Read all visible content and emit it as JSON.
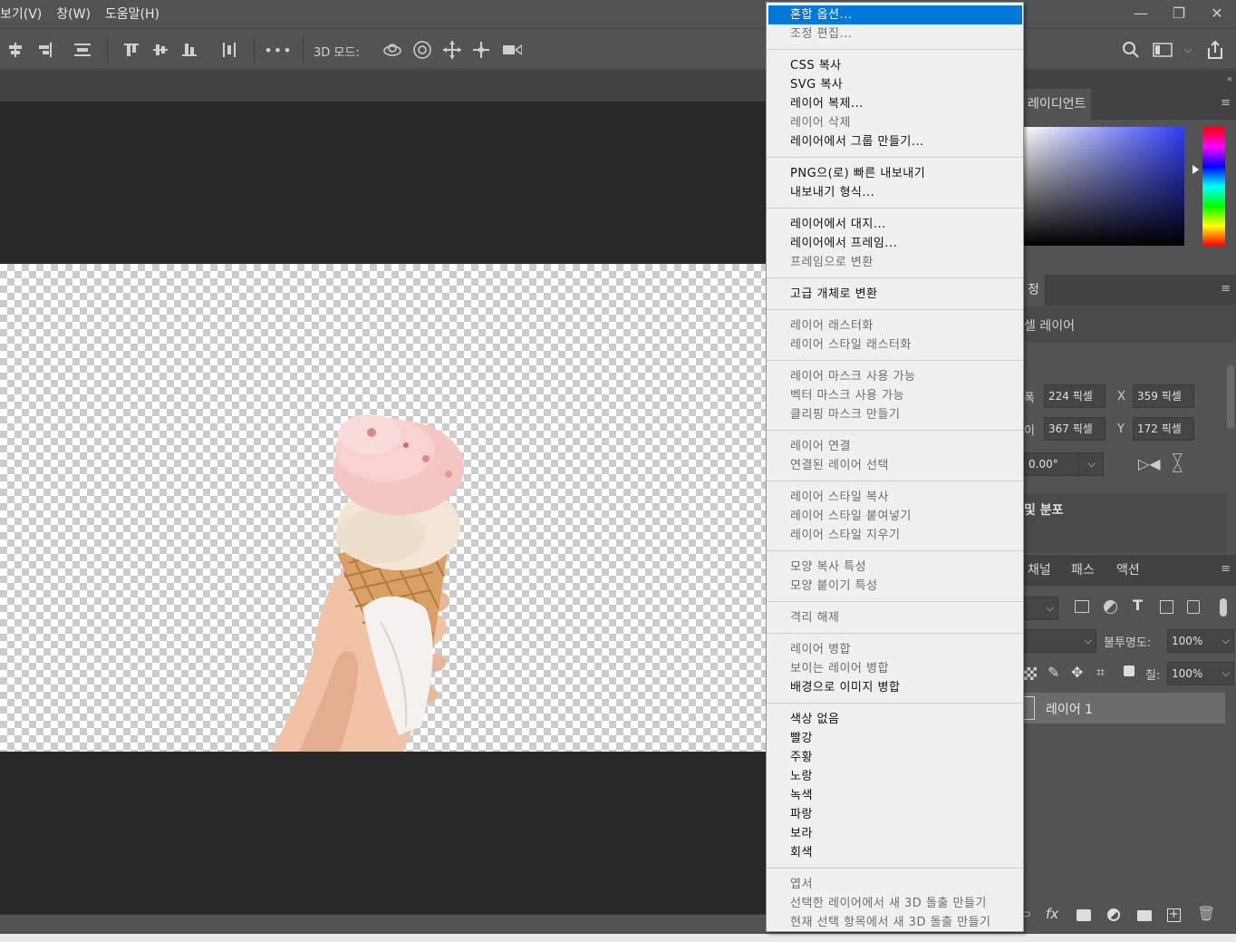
{
  "menubar": {
    "items": [
      "보기(V)",
      "창(W)",
      "도움말(H)"
    ]
  },
  "window_controls": {
    "minimize": "—",
    "restore": "❐",
    "close": "✕"
  },
  "toolbar": {
    "mode_label": "3D 모드:"
  },
  "context_menu": {
    "groups": [
      [
        {
          "label": "혼합 옵션...",
          "state": "selected"
        },
        {
          "label": "조정 편집...",
          "state": "disabled"
        }
      ],
      [
        {
          "label": "CSS 복사",
          "state": "enabled"
        },
        {
          "label": "SVG 복사",
          "state": "enabled"
        },
        {
          "label": "레이어 복제...",
          "state": "enabled"
        },
        {
          "label": "레이어 삭제",
          "state": "disabled"
        },
        {
          "label": "레이어에서 그룹 만들기...",
          "state": "enabled"
        }
      ],
      [
        {
          "label": "PNG으(로) 빠른 내보내기",
          "state": "enabled"
        },
        {
          "label": "내보내기 형식...",
          "state": "enabled"
        }
      ],
      [
        {
          "label": "레이어에서 대지...",
          "state": "enabled"
        },
        {
          "label": "레이어에서 프레임...",
          "state": "enabled"
        },
        {
          "label": "프레임으로 변환",
          "state": "disabled"
        }
      ],
      [
        {
          "label": "고급 개체로 변환",
          "state": "enabled"
        }
      ],
      [
        {
          "label": "레이어 래스터화",
          "state": "disabled"
        },
        {
          "label": "레이어 스타일 래스터화",
          "state": "disabled"
        }
      ],
      [
        {
          "label": "레이어 마스크 사용 가능",
          "state": "disabled"
        },
        {
          "label": "벡터 마스크 사용 가능",
          "state": "disabled"
        },
        {
          "label": "클리핑 마스크 만들기",
          "state": "disabled"
        }
      ],
      [
        {
          "label": "레이어 연결",
          "state": "disabled"
        },
        {
          "label": "연결된 레이어 선택",
          "state": "disabled"
        }
      ],
      [
        {
          "label": "레이어 스타일 복사",
          "state": "disabled"
        },
        {
          "label": "레이어 스타일 붙여넣기",
          "state": "disabled"
        },
        {
          "label": "레이어 스타일 지우기",
          "state": "disabled"
        }
      ],
      [
        {
          "label": "모양 복사 특성",
          "state": "disabled"
        },
        {
          "label": "모양 붙이기 특성",
          "state": "disabled"
        }
      ],
      [
        {
          "label": "격리 해제",
          "state": "disabled"
        }
      ],
      [
        {
          "label": "레이어 병합",
          "state": "disabled"
        },
        {
          "label": "보이는 레이어 병합",
          "state": "disabled"
        },
        {
          "label": "배경으로 이미지 병합",
          "state": "enabled"
        }
      ],
      [
        {
          "label": "색상 없음",
          "state": "enabled"
        },
        {
          "label": "빨강",
          "state": "enabled"
        },
        {
          "label": "주황",
          "state": "enabled"
        },
        {
          "label": "노랑",
          "state": "enabled"
        },
        {
          "label": "녹색",
          "state": "enabled"
        },
        {
          "label": "파랑",
          "state": "enabled"
        },
        {
          "label": "보라",
          "state": "enabled"
        },
        {
          "label": "회색",
          "state": "enabled"
        }
      ],
      [
        {
          "label": "엽서",
          "state": "disabled"
        },
        {
          "label": "선택한 레이어에서 새 3D 돌출 만들기",
          "state": "disabled"
        },
        {
          "label": "현재 선택 항목에서 새 3D 돌출 만들기",
          "state": "disabled"
        }
      ]
    ]
  },
  "gradient_panel": {
    "tab_label": "레이디언트"
  },
  "properties_panel": {
    "tab_label": "정",
    "layer_type": "셀 레이어",
    "w_label": "폭",
    "w_value": "224 픽셀",
    "h_label": "이",
    "h_value": "367 픽셀",
    "x_label": "X",
    "x_value": "359 픽셀",
    "y_label": "Y",
    "y_value": "172 픽셀",
    "angle_value": "0.00°",
    "distribute_label": "및 분포"
  },
  "layers_panel": {
    "tabs": [
      "채널",
      "패스",
      "액션"
    ],
    "opacity_label": "불투명도:",
    "opacity_value": "100%",
    "fill_label": "칠:",
    "fill_value": "100%",
    "layer_name": "레이어 1",
    "fx_label": "fx"
  },
  "colors": {
    "menu_highlight": "#0078d7",
    "app_bg": "#535353",
    "canvas_bg": "#282828"
  }
}
